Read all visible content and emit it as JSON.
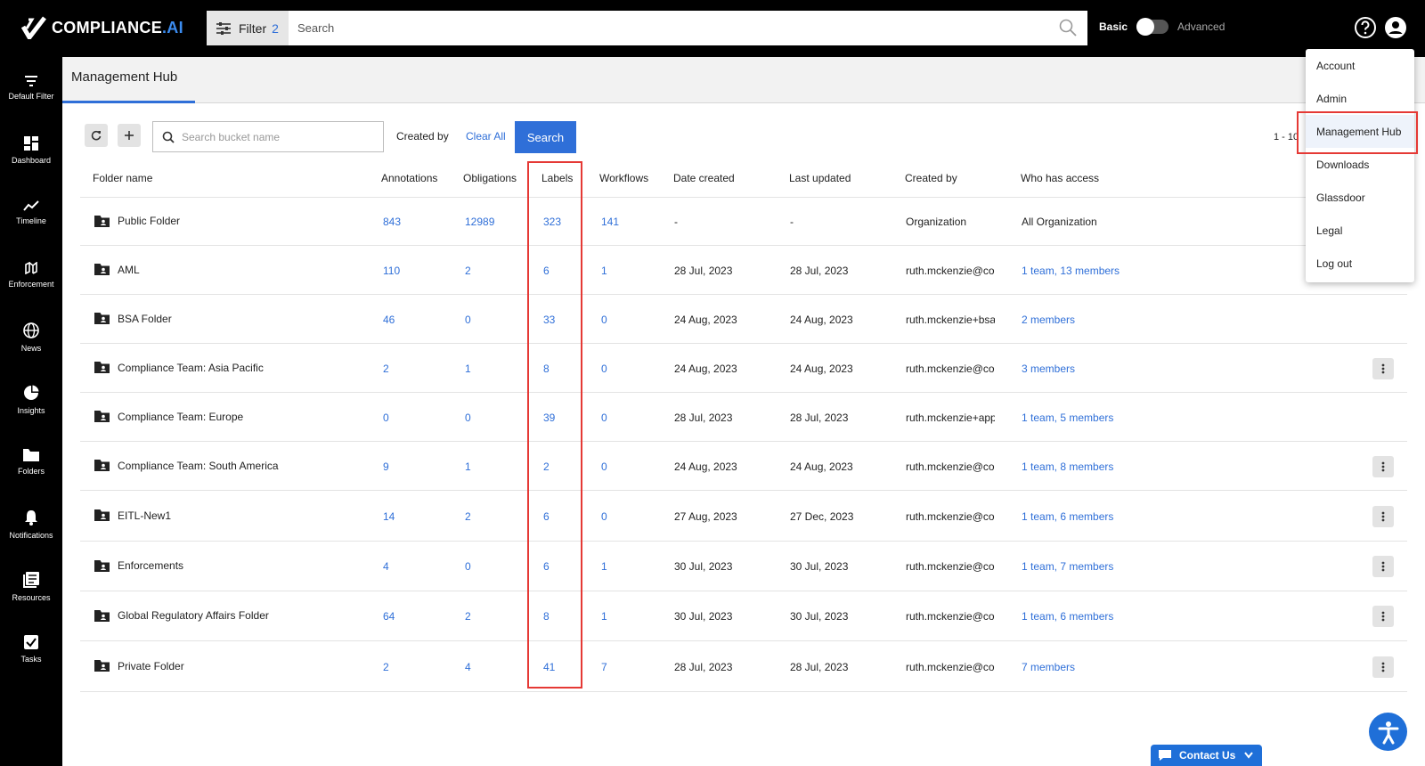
{
  "app": {
    "logo_text": "COMPLIANCE",
    "logo_suffix": ".AI"
  },
  "topbar": {
    "filter_label": "Filter",
    "filter_count": "2",
    "search_placeholder": "Search",
    "mode_basic": "Basic",
    "mode_advanced": "Advanced"
  },
  "sidebar": {
    "items": [
      {
        "label": "Default Filter",
        "icon": "filter-lines-icon"
      },
      {
        "label": "Dashboard",
        "icon": "dashboard-icon"
      },
      {
        "label": "Timeline",
        "icon": "timeline-icon"
      },
      {
        "label": "Enforcement",
        "icon": "enforcement-icon"
      },
      {
        "label": "News",
        "icon": "globe-icon"
      },
      {
        "label": "Insights",
        "icon": "pie-chart-icon"
      },
      {
        "label": "Folders",
        "icon": "folder-icon"
      },
      {
        "label": "Notifications",
        "icon": "bell-icon"
      },
      {
        "label": "Resources",
        "icon": "resources-icon"
      },
      {
        "label": "Tasks",
        "icon": "checkbox-icon"
      }
    ]
  },
  "header": {
    "tab": "Management Hub"
  },
  "toolbar": {
    "bucket_placeholder": "Search bucket name",
    "created_by": "Created by",
    "clear_all": "Clear All",
    "search": "Search",
    "pager": "1 - 10"
  },
  "table": {
    "columns": [
      "Folder name",
      "Annotations",
      "Obligations",
      "Labels",
      "Workflows",
      "Date created",
      "Last updated",
      "Created by",
      "Who has access"
    ],
    "rows": [
      {
        "name": "Public Folder",
        "annotations": "843",
        "obligations": "12989",
        "labels": "323",
        "workflows": "141",
        "created": "-",
        "updated": "-",
        "creator": "Organization",
        "access": "All Organization",
        "access_link": false,
        "menu": false
      },
      {
        "name": "AML",
        "annotations": "110",
        "obligations": "2",
        "labels": "6",
        "workflows": "1",
        "created": "28 Jul, 2023",
        "updated": "28 Jul, 2023",
        "creator": "ruth.mckenzie@co",
        "access": "1 team, 13 members",
        "access_link": true,
        "menu": false
      },
      {
        "name": "BSA Folder",
        "annotations": "46",
        "obligations": "0",
        "labels": "33",
        "workflows": "0",
        "created": "24 Aug, 2023",
        "updated": "24 Aug, 2023",
        "creator": "ruth.mckenzie+bsa",
        "access": "2 members",
        "access_link": true,
        "menu": false
      },
      {
        "name": "Compliance Team: Asia Pacific",
        "annotations": "2",
        "obligations": "1",
        "labels": "8",
        "workflows": "0",
        "created": "24 Aug, 2023",
        "updated": "24 Aug, 2023",
        "creator": "ruth.mckenzie@co",
        "access": "3 members",
        "access_link": true,
        "menu": true
      },
      {
        "name": "Compliance Team: Europe",
        "annotations": "0",
        "obligations": "0",
        "labels": "39",
        "workflows": "0",
        "created": "28 Jul, 2023",
        "updated": "28 Jul, 2023",
        "creator": "ruth.mckenzie+app",
        "access": "1 team, 5 members",
        "access_link": true,
        "menu": false
      },
      {
        "name": "Compliance Team: South America",
        "annotations": "9",
        "obligations": "1",
        "labels": "2",
        "workflows": "0",
        "created": "24 Aug, 2023",
        "updated": "24 Aug, 2023",
        "creator": "ruth.mckenzie@co",
        "access": "1 team, 8 members",
        "access_link": true,
        "menu": true
      },
      {
        "name": "EITL-New1",
        "annotations": "14",
        "obligations": "2",
        "labels": "6",
        "workflows": "0",
        "created": "27 Aug, 2023",
        "updated": "27 Dec, 2023",
        "creator": "ruth.mckenzie@co",
        "access": "1 team, 6 members",
        "access_link": true,
        "menu": true
      },
      {
        "name": "Enforcements",
        "annotations": "4",
        "obligations": "0",
        "labels": "6",
        "workflows": "1",
        "created": "30 Jul, 2023",
        "updated": "30 Jul, 2023",
        "creator": "ruth.mckenzie@co",
        "access": "1 team, 7 members",
        "access_link": true,
        "menu": true
      },
      {
        "name": "Global Regulatory Affairs Folder",
        "annotations": "64",
        "obligations": "2",
        "labels": "8",
        "workflows": "1",
        "created": "30 Jul, 2023",
        "updated": "30 Jul, 2023",
        "creator": "ruth.mckenzie@co",
        "access": "1 team, 6 members",
        "access_link": true,
        "menu": true
      },
      {
        "name": "Private Folder",
        "annotations": "2",
        "obligations": "4",
        "labels": "41",
        "workflows": "7",
        "created": "28 Jul, 2023",
        "updated": "28 Jul, 2023",
        "creator": "ruth.mckenzie@co",
        "access": "7 members",
        "access_link": true,
        "menu": true
      }
    ]
  },
  "user_menu": {
    "items": [
      "Account",
      "Admin",
      "Management Hub",
      "Downloads",
      "Glassdoor",
      "Legal",
      "Log out"
    ],
    "active": "Management Hub"
  },
  "footer": {
    "contact": "Contact Us"
  },
  "colors": {
    "accent": "#2f6fd8",
    "highlight": "#e53935"
  }
}
